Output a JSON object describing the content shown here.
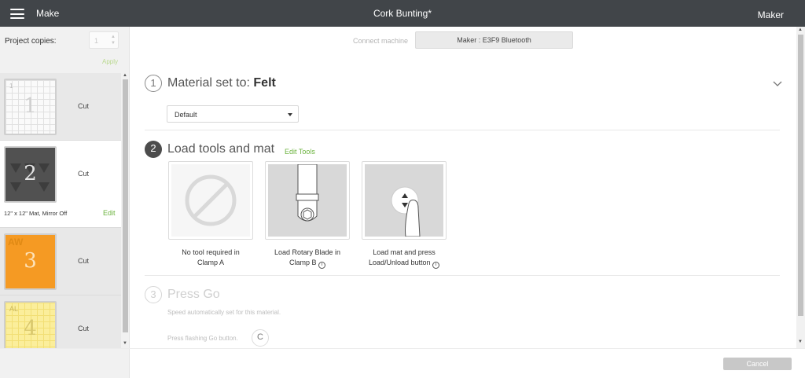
{
  "header": {
    "menu_icon": "hamburger-menu-icon",
    "section": "Make",
    "title": "Cork Bunting*",
    "machine": "Maker"
  },
  "sidebar": {
    "copies_label": "Project copies:",
    "copies_value": "1",
    "apply_label": "Apply",
    "mats": [
      {
        "number": "1",
        "label": "Cut",
        "color": "#fafafa",
        "preview_text": "1"
      },
      {
        "number": "2",
        "label": "Cut",
        "color": "#515151",
        "info": "12\" x 12\" Mat, Mirror Off",
        "edit_label": "Edit"
      },
      {
        "number": "3",
        "label": "Cut",
        "color": "#f59a23",
        "preview_text": "AW"
      },
      {
        "number": "4",
        "label": "Cut",
        "color": "#fbee9b",
        "preview_text": "AL"
      }
    ]
  },
  "main": {
    "connect_label": "Connect machine",
    "machine_button": "Maker : E3F9 Bluetooth",
    "step1": {
      "number": "1",
      "title": "Material set to:",
      "material": "Felt",
      "dropdown_value": "Default"
    },
    "step2": {
      "number": "2",
      "title": "Load tools and mat",
      "edit_tools": "Edit Tools",
      "tools": [
        {
          "icon": "no-tool-icon",
          "caption_line1": "No tool required in",
          "caption_line2": "Clamp A"
        },
        {
          "icon": "rotary-blade-icon",
          "caption_line1": "Load Rotary Blade in",
          "caption_line2": "Clamp B"
        },
        {
          "icon": "load-mat-button-icon",
          "caption_line1": "Load mat and press",
          "caption_line2": "Load/Unload button"
        }
      ]
    },
    "step3": {
      "number": "3",
      "title": "Press Go",
      "subtitle": "Speed automatically set for this material.",
      "go_text": "Press flashing Go button."
    }
  },
  "footer": {
    "cancel_label": "Cancel"
  },
  "colors": {
    "topbar": "#414549",
    "accent_green": "#6cb33f",
    "sidebar_bg": "#f1f1f1"
  }
}
